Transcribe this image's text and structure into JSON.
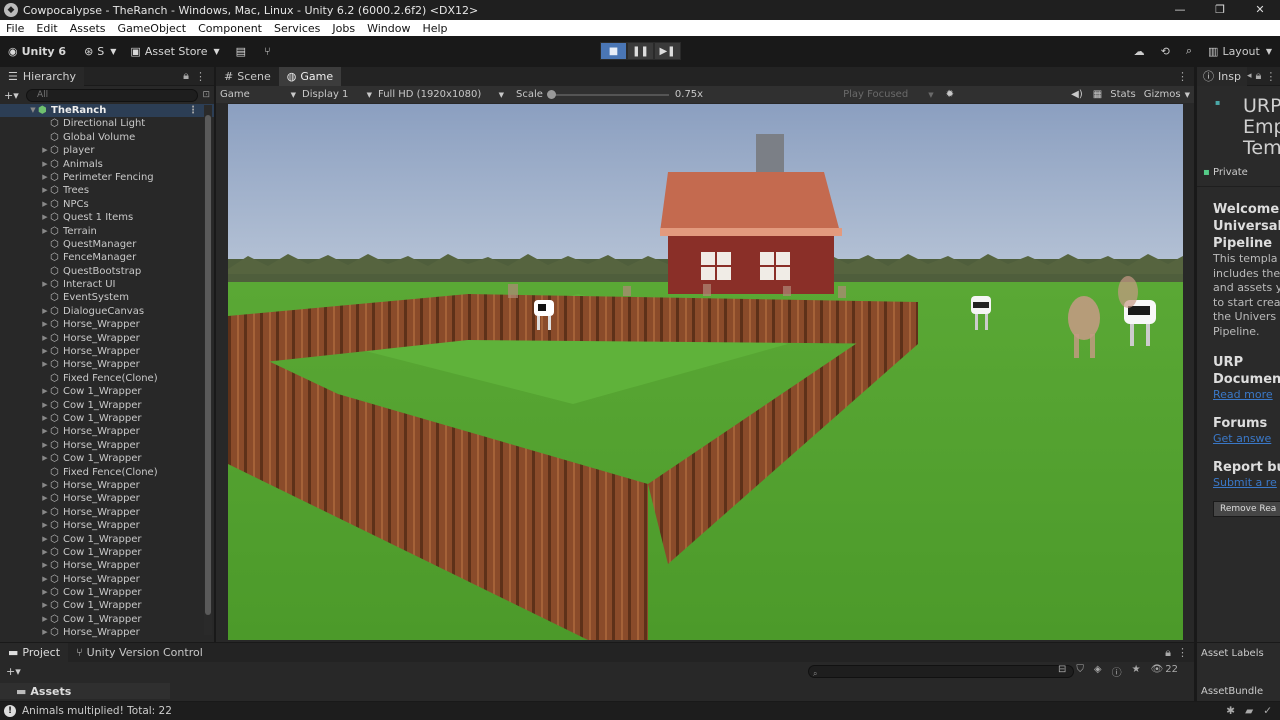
{
  "window": {
    "title": "Cowpocalypse - TheRanch - Windows, Mac, Linux - Unity 6.2 (6000.2.6f2) <DX12>",
    "controls": [
      "—",
      "❐",
      "✕"
    ]
  },
  "menu": [
    "File",
    "Edit",
    "Assets",
    "GameObject",
    "Component",
    "Services",
    "Jobs",
    "Window",
    "Help"
  ],
  "toolbar": {
    "unity_label": "Unity 6",
    "account_label": "S",
    "asset_store_label": "Asset Store",
    "layout_label": "Layout"
  },
  "hierarchy": {
    "tab_label": "Hierarchy",
    "search_placeholder": "All",
    "root": "TheRanch",
    "items": [
      "Directional Light",
      "Global Volume",
      "player",
      "Animals",
      "Perimeter Fencing",
      "Trees",
      "NPCs",
      "Quest 1 Items",
      "Terrain",
      "QuestManager",
      "FenceManager",
      "QuestBootstrap",
      "Interact UI",
      "EventSystem",
      "DialogueCanvas",
      "Horse_Wrapper",
      "Horse_Wrapper",
      "Horse_Wrapper",
      "Horse_Wrapper",
      "Fixed Fence(Clone)",
      "Cow 1_Wrapper",
      "Cow 1_Wrapper",
      "Cow 1_Wrapper",
      "Horse_Wrapper",
      "Horse_Wrapper",
      "Cow 1_Wrapper",
      "Fixed Fence(Clone)",
      "Horse_Wrapper",
      "Horse_Wrapper",
      "Horse_Wrapper",
      "Horse_Wrapper",
      "Cow 1_Wrapper",
      "Cow 1_Wrapper",
      "Horse_Wrapper",
      "Horse_Wrapper",
      "Cow 1_Wrapper",
      "Cow 1_Wrapper",
      "Cow 1_Wrapper",
      "Horse_Wrapper"
    ],
    "arrow_flags": [
      false,
      false,
      true,
      true,
      true,
      true,
      true,
      true,
      true,
      false,
      false,
      false,
      true,
      false,
      true,
      true,
      true,
      true,
      true,
      false,
      true,
      true,
      true,
      true,
      true,
      true,
      false,
      true,
      true,
      true,
      true,
      true,
      true,
      true,
      true,
      true,
      true,
      true,
      true
    ]
  },
  "game_view": {
    "tabs": [
      "Scene",
      "Game"
    ],
    "display_mode": "Game",
    "display": "Display 1",
    "resolution": "Full HD (1920x1080)",
    "scale_label": "Scale",
    "scale_value": "0.75x",
    "play_focused": "Play Focused",
    "stats": "Stats",
    "gizmos": "Gizmos"
  },
  "inspector": {
    "tab_label": "Insp",
    "title_lines": [
      "URP",
      "Emp",
      "Tem"
    ],
    "private_label": "Private",
    "welcome_heading": [
      "Welcome",
      "Universal",
      "Pipeline"
    ],
    "welcome_body": [
      "This templa",
      "includes the",
      "and assets y",
      "to start crea",
      "the Univers",
      "Pipeline."
    ],
    "urp_doc_heading": [
      "URP",
      "Documen"
    ],
    "urp_doc_link": "Read more",
    "forums_heading": "Forums",
    "forums_link": "Get answe",
    "report_heading": "Report bu",
    "report_link": "Submit a re",
    "remove_button": "Remove Rea"
  },
  "project": {
    "tabs": [
      "Project",
      "Unity Version Control"
    ],
    "assets_label": "Assets",
    "count": "22"
  },
  "asset_panel": {
    "labels": "Asset Labels",
    "bundle": "AssetBundle"
  },
  "status": {
    "message": "Animals multiplied! Total: 22"
  },
  "colors": {
    "accent_blue": "#4a76b5",
    "sky": "#8fa3c2",
    "grass": "#4f9a2c",
    "fence": "#8a4b2a",
    "barn": "#8a2f28",
    "roof": "#c96a4e"
  }
}
